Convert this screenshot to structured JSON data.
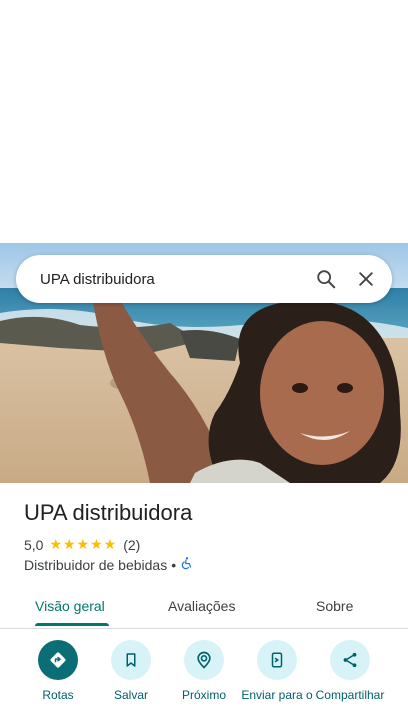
{
  "search": {
    "query": "UPA distribuidora"
  },
  "place": {
    "name": "UPA distribuidora",
    "rating": "5,0",
    "stars": "★★★★★",
    "review_count": "(2)",
    "category": "Distribuidor de bebidas",
    "separator": "•"
  },
  "tabs": [
    {
      "label": "Visão geral",
      "active": true
    },
    {
      "label": "Avaliações",
      "active": false
    },
    {
      "label": "Sobre",
      "active": false
    }
  ],
  "actions": [
    {
      "label": "Rotas",
      "icon": "directions-icon"
    },
    {
      "label": "Salvar",
      "icon": "bookmark-icon"
    },
    {
      "label": "Próximo",
      "icon": "nearby-icon"
    },
    {
      "label": "Enviar para o",
      "icon": "send-to-phone-icon"
    },
    {
      "label": "Compartilhar",
      "icon": "share-icon"
    }
  ],
  "colors": {
    "accent": "#00796b",
    "primary_action": "#0b6e76",
    "action_bg": "#d7f3f8",
    "star": "#fbbc04",
    "accessibility": "#1a73e8"
  }
}
